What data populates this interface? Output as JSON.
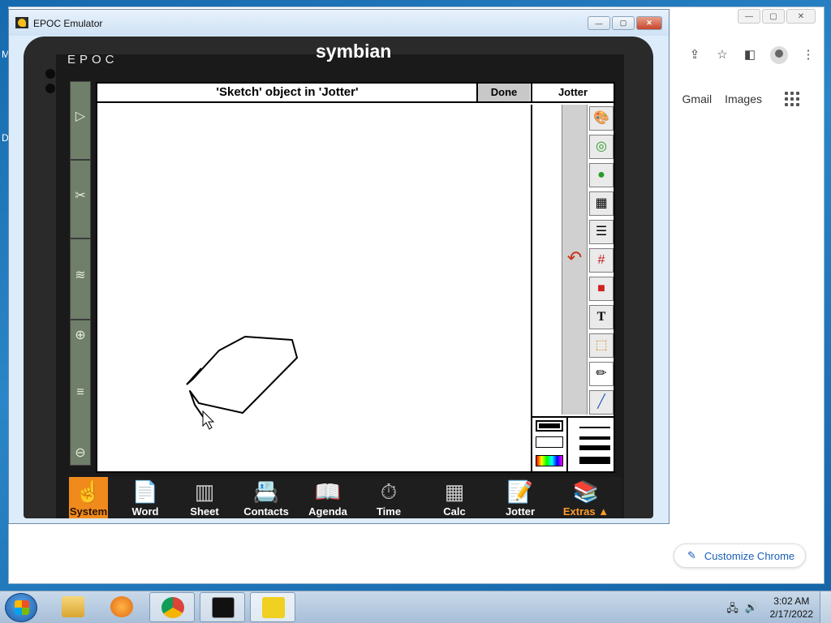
{
  "desktop": {
    "edge_letters": [
      "M",
      "D"
    ]
  },
  "chrome": {
    "links": [
      "Gmail",
      "Images"
    ],
    "customize_label": "Customize Chrome",
    "toolbar_icons": [
      "share-icon",
      "star-icon",
      "side-panel-icon",
      "profile-icon",
      "menu-icon"
    ]
  },
  "emulator": {
    "window_title": "EPOC Emulator",
    "brand_left": "EPOC",
    "brand_right": "symbian",
    "screen": {
      "title": "'Sketch' object in 'Jotter'",
      "done_label": "Done",
      "app_label": "Jotter",
      "tools": [
        "paint-icon",
        "zoom-in-shape-icon",
        "fill-ellipse-icon",
        "image-icon",
        "layers-icon",
        "grid-icon",
        "fill-rect-icon",
        "text-tool-icon",
        "select-rect-icon",
        "pencil-icon",
        "line-icon"
      ],
      "undo_icon": "undo-icon"
    },
    "sidebar_icons": [
      "menu-icon",
      "clipboard-icon",
      "infrared-icon",
      "zoom-in-icon",
      "zoom-slider-icon",
      "zoom-out-icon"
    ],
    "dock": [
      {
        "label": "System",
        "icon": "system-icon"
      },
      {
        "label": "Word",
        "icon": "word-icon"
      },
      {
        "label": "Sheet",
        "icon": "sheet-icon"
      },
      {
        "label": "Contacts",
        "icon": "contacts-icon"
      },
      {
        "label": "Agenda",
        "icon": "agenda-icon"
      },
      {
        "label": "Time",
        "icon": "time-icon"
      },
      {
        "label": "Calc",
        "icon": "calc-icon"
      },
      {
        "label": "Jotter",
        "icon": "jotter-icon"
      },
      {
        "label": "Extras ▲",
        "icon": "extras-icon"
      }
    ]
  },
  "taskbar": {
    "clock_time": "3:02 AM",
    "clock_date": "2/17/2022",
    "pinned": [
      "explorer-icon",
      "media-player-icon",
      "chrome-icon",
      "cmd-icon",
      "epoc-icon"
    ]
  },
  "colors": {
    "accent_orange": "#f08a1c",
    "desktop_blue": "#1b6fb2"
  }
}
